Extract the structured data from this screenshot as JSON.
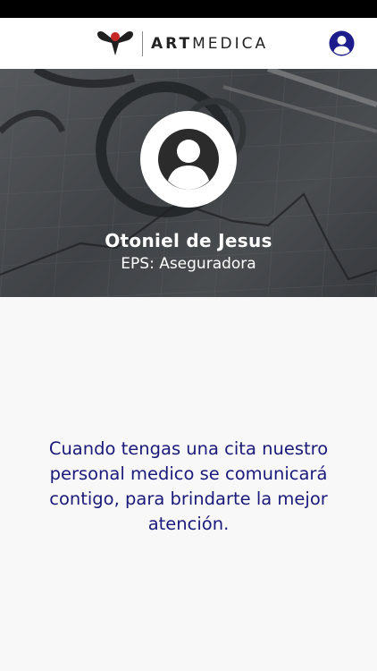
{
  "header": {
    "logo_text_bold": "ART",
    "logo_text_light": "MEDICA",
    "colors": {
      "logo_dark": "#1f1f1f",
      "logo_accent": "#c62828",
      "user_icon": "#1c1c8c"
    }
  },
  "profile": {
    "name": "Otoniel de Jesus",
    "eps": "EPS: Aseguradora"
  },
  "message": {
    "text": "Cuando tengas una cita nuestro personal medico se comunicará contigo, para brindarte la mejor atención."
  },
  "icons": {
    "user_button": "user-circle-icon",
    "avatar": "person-placeholder-icon"
  },
  "colors": {
    "status_bar": "#000000",
    "header_bg": "#ffffff",
    "page_bg": "#f8f8f8",
    "message_text": "#1a1a7a"
  }
}
